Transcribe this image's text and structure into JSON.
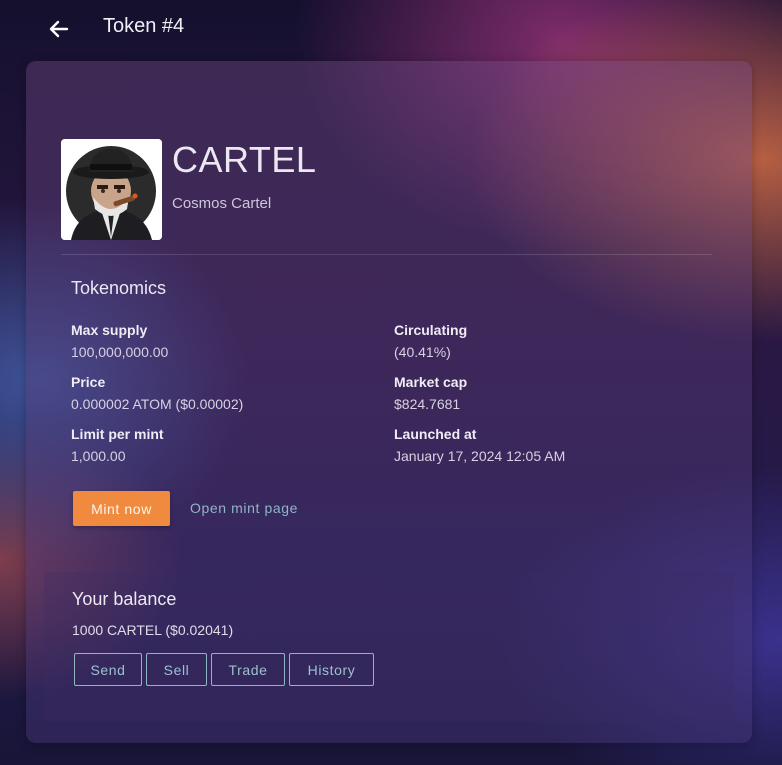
{
  "header": {
    "back_icon": "arrow-left-icon",
    "title": "Token #4"
  },
  "token": {
    "symbol": "CARTEL",
    "name": "Cosmos Cartel",
    "image_icon": "gangster-avatar-icon"
  },
  "tokenomics": {
    "title": "Tokenomics",
    "fields": {
      "max_supply": {
        "label": "Max supply",
        "value": "100,000,000.00"
      },
      "circulating": {
        "label": "Circulating",
        "value": "(40.41%)"
      },
      "price": {
        "label": "Price",
        "value": "0.000002 ATOM ($0.00002)"
      },
      "market_cap": {
        "label": "Market cap",
        "value": "$824.7681"
      },
      "limit_per_mint": {
        "label": "Limit per mint",
        "value": "1,000.00"
      },
      "launched_at": {
        "label": "Launched at",
        "value": "January 17, 2024 12:05 AM"
      }
    },
    "mint_button": "Mint now",
    "open_mint_link": "Open mint page"
  },
  "balance": {
    "title": "Your balance",
    "value": "1000 CARTEL ($0.02041)",
    "actions": [
      "Send",
      "Sell",
      "Trade",
      "History"
    ]
  },
  "colors": {
    "accent_orange": "#ef8a3f",
    "link_teal": "#8fb6c4"
  }
}
